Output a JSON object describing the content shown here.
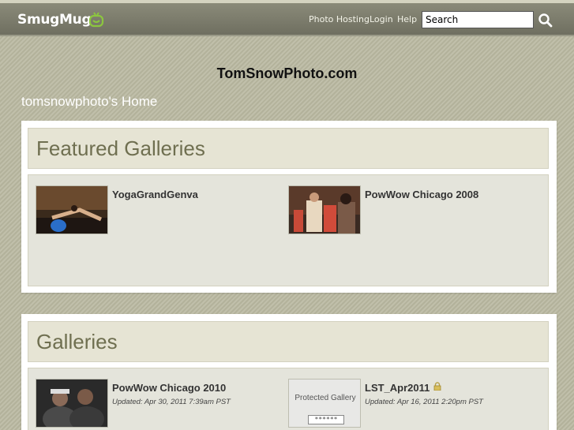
{
  "header": {
    "logo": "SmugMug",
    "logo_icon": "smugmug-smile-icon",
    "nav": [
      "Photo Hosting",
      "Login",
      "Help"
    ],
    "search_value": "Search",
    "search_icon": "search-icon"
  },
  "site_title": "TomSnowPhoto.com",
  "home_title": "tomsnowphoto's Home",
  "featured": {
    "heading": "Featured Galleries",
    "items": [
      {
        "name": "YogaGrandGenva"
      },
      {
        "name": "PowWow Chicago 2008"
      }
    ]
  },
  "galleries": {
    "heading": "Galleries",
    "items": [
      {
        "name": "PowWow Chicago 2010",
        "updated": "Updated: Apr 30, 2011 7:39am PST"
      },
      {
        "name": "LST_Apr2011",
        "updated": "Updated: Apr 16, 2011 2:20pm PST",
        "locked": true,
        "thumb_text": "Protected Gallery",
        "thumb_mask": "******"
      }
    ]
  },
  "colors": {
    "accent": "#8cc63f",
    "bar": "#7b7b6b",
    "heading": "#6f6f50"
  }
}
